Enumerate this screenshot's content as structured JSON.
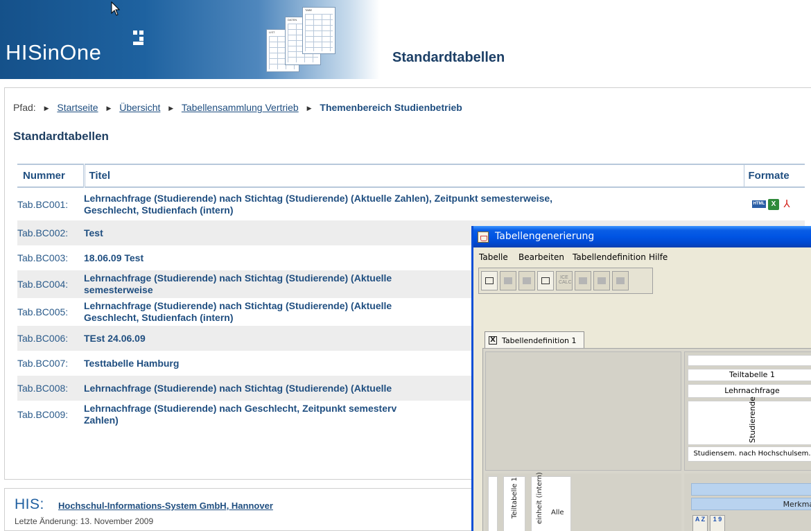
{
  "header": {
    "logo_text": "HISinOne",
    "page_title": "Standardtabellen",
    "sheet_titles": [
      "TABE",
      "DATEN",
      "LIST"
    ]
  },
  "breadcrumb": {
    "prefix": "Pfad:",
    "items": [
      "Startseite",
      "Übersicht",
      "Tabellensammlung Vertrieb"
    ],
    "current": "Themenbereich Studienbetrieb"
  },
  "section_title": "Standardtabellen",
  "table": {
    "headers": {
      "number": "Nummer",
      "title": "Titel",
      "formats": "Formate"
    },
    "rows": [
      {
        "number": "Tab.BC001:",
        "title_line1": "Lehrnachfrage (Studierende) nach Stichtag (Studierende) (Aktuelle Zahlen), Zeitpunkt semesterweise,",
        "title_line2": "Geschlecht, Studienfach (intern)"
      },
      {
        "number": "Tab.BC002:",
        "title_line1": "Test",
        "title_line2": ""
      },
      {
        "number": "Tab.BC003:",
        "title_line1": "18.06.09 Test",
        "title_line2": ""
      },
      {
        "number": "Tab.BC004:",
        "title_line1": "Lehrnachfrage (Studierende) nach Stichtag (Studierende) (Aktuelle",
        "title_line2": "semesterweise"
      },
      {
        "number": "Tab.BC005:",
        "title_line1": "Lehrnachfrage (Studierende) nach Stichtag (Studierende) (Aktuelle",
        "title_line2": "Geschlecht, Studienfach (intern)"
      },
      {
        "number": "Tab.BC006:",
        "title_line1": "TEst 24.06.09",
        "title_line2": ""
      },
      {
        "number": "Tab.BC007:",
        "title_line1": "Testtabelle Hamburg",
        "title_line2": ""
      },
      {
        "number": "Tab.BC008:",
        "title_line1": "Lehrnachfrage (Studierende) nach Stichtag (Studierende) (Aktuelle",
        "title_line2": ""
      },
      {
        "number": "Tab.BC009:",
        "title_line1": "Lehrnachfrage (Studierende) nach Geschlecht, Zeitpunkt semesterv",
        "title_line2": "Zahlen)"
      }
    ],
    "format_icons": [
      "html-icon",
      "excel-icon",
      "pdf-icon"
    ],
    "format_html_label": "HTML",
    "format_xls_label": "X"
  },
  "footer": {
    "brand": "HIS:",
    "link": "Hochschul-Informations-System GmbH, Hannover",
    "last_change": "Letzte Änderung: 13. November 2009"
  },
  "dialog": {
    "title": "Tabellengenerierung",
    "menu": [
      "Tabelle",
      "Bearbeiten",
      "Tabellendefinition",
      "Hilfe"
    ],
    "toolbar_calc_label": "ICE CALC",
    "tab_label": "Tabellendefinition 1",
    "tab_close": "X",
    "cells": {
      "teiltabelle": "Teiltabelle 1",
      "lehrnachfrage": "Lehrnachfrage",
      "studierende": "Studierende",
      "studiensem": "Studiensem. nach Hochschulsem.",
      "teiltabelle_vert": "Teiltabelle 1",
      "einheit_vert": "einheit (intern)",
      "alle": "Alle",
      "merkmale": "Merkmale",
      "sort_az": "A Z",
      "sort_19": "1 9"
    }
  },
  "colors": {
    "brand_blue": "#1f4e80",
    "banner_blue": "#15518a",
    "xp_title_blue": "#0054e3"
  }
}
